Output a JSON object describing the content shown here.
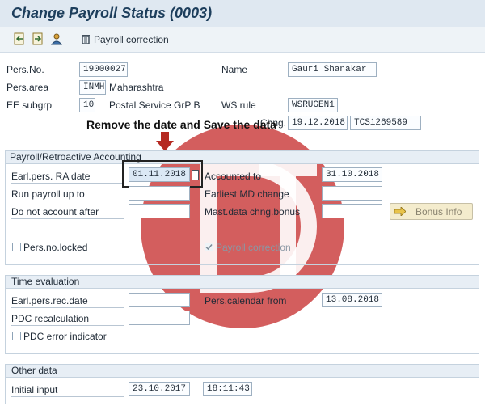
{
  "title": "Change Payroll Status (0003)",
  "toolbar": {
    "payroll_correction": "Payroll correction"
  },
  "header": {
    "pers_no_label": "Pers.No.",
    "pers_no": "19000027",
    "name_label": "Name",
    "name": "Gauri Shanakar",
    "pers_area_label": "Pers.area",
    "pers_area_code": "INMH",
    "pers_area_text": "Maharashtra",
    "ee_subgrp_label": "EE subgrp",
    "ee_subgrp_code": "10",
    "ee_subgrp_text": "Postal Service GrP B",
    "ws_rule_label": "WS rule",
    "ws_rule": "WSRUGEN1",
    "chng_label": "Chng.",
    "chng_date": "19.12.2018",
    "chng_user": "TCS1269589"
  },
  "annotation": {
    "text": "Remove the date and Save the data",
    "color": "#c0392b"
  },
  "payroll": {
    "title": "Payroll/Retroactive Accounting",
    "earl_ra_label": "Earl.pers. RA date",
    "earl_ra": "01.11.2018",
    "accounted_label": "Accounted to",
    "accounted": "31.10.2018",
    "run_payroll_label": "Run payroll up to",
    "run_payroll": "",
    "earliest_md_label": "Earliest MD change",
    "earliest_md": "",
    "do_not_account_label": "Do not account after",
    "do_not_account": "",
    "mast_data_label": "Mast.data chng.bonus",
    "mast_data": "",
    "bonus_info": "Bonus Info",
    "locked_label": "Pers.no.locked",
    "locked": false,
    "payroll_correction_label": "Payroll correction",
    "payroll_correction": true
  },
  "time_eval": {
    "title": "Time evaluation",
    "earl_rec_label": "Earl.pers.rec.date",
    "earl_rec": "",
    "pers_cal_label": "Pers.calendar from",
    "pers_cal": "13.08.2018",
    "pdc_recalc_label": "PDC recalculation",
    "pdc_recalc": "",
    "pdc_error_label": "PDC error indicator",
    "pdc_error": false
  },
  "other": {
    "title": "Other data",
    "initial_input_label": "Initial input",
    "initial_date": "23.10.2017",
    "initial_time": "18:11:43"
  },
  "colors": {
    "watermark": "#c93a3a",
    "highlight_box": "#222222",
    "arrow": "#b52a22"
  }
}
